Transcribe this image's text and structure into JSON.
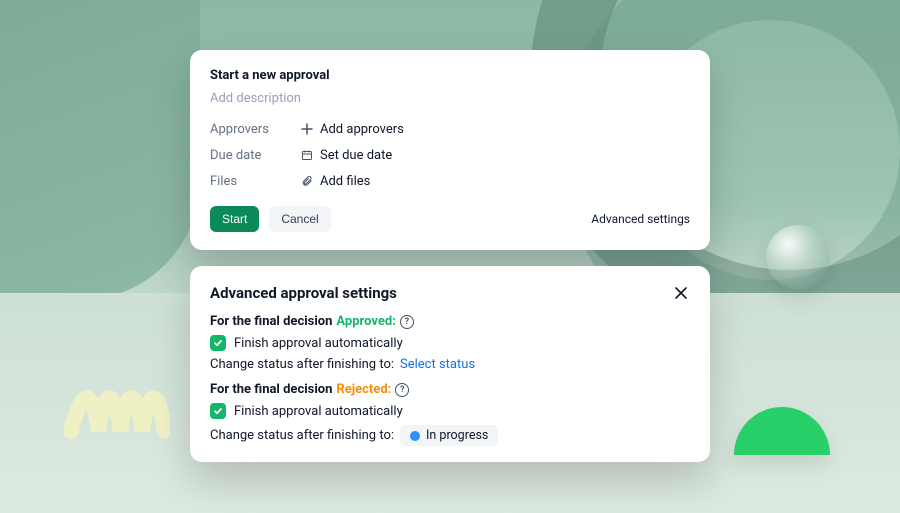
{
  "approvalCard": {
    "title": "Start a new approval",
    "descriptionPlaceholder": "Add description",
    "fields": {
      "approvers": {
        "label": "Approvers",
        "action": "Add approvers"
      },
      "dueDate": {
        "label": "Due date",
        "action": "Set due date"
      },
      "files": {
        "label": "Files",
        "action": "Add files"
      }
    },
    "buttons": {
      "start": "Start",
      "cancel": "Cancel",
      "advanced": "Advanced settings"
    }
  },
  "settingsCard": {
    "title": "Advanced approval settings",
    "sectionPrefix": "For the final decision ",
    "approved": {
      "decisionLabel": "Approved:",
      "finishLabel": "Finish approval automatically",
      "finishChecked": true,
      "changeStatusLabel": "Change status after finishing to:",
      "statusSelectPlaceholder": "Select status"
    },
    "rejected": {
      "decisionLabel": "Rejected:",
      "finishLabel": "Finish approval automatically",
      "finishChecked": true,
      "changeStatusLabel": "Change status after finishing to:",
      "statusValue": "In progress",
      "statusColor": "#2e90fa"
    }
  }
}
